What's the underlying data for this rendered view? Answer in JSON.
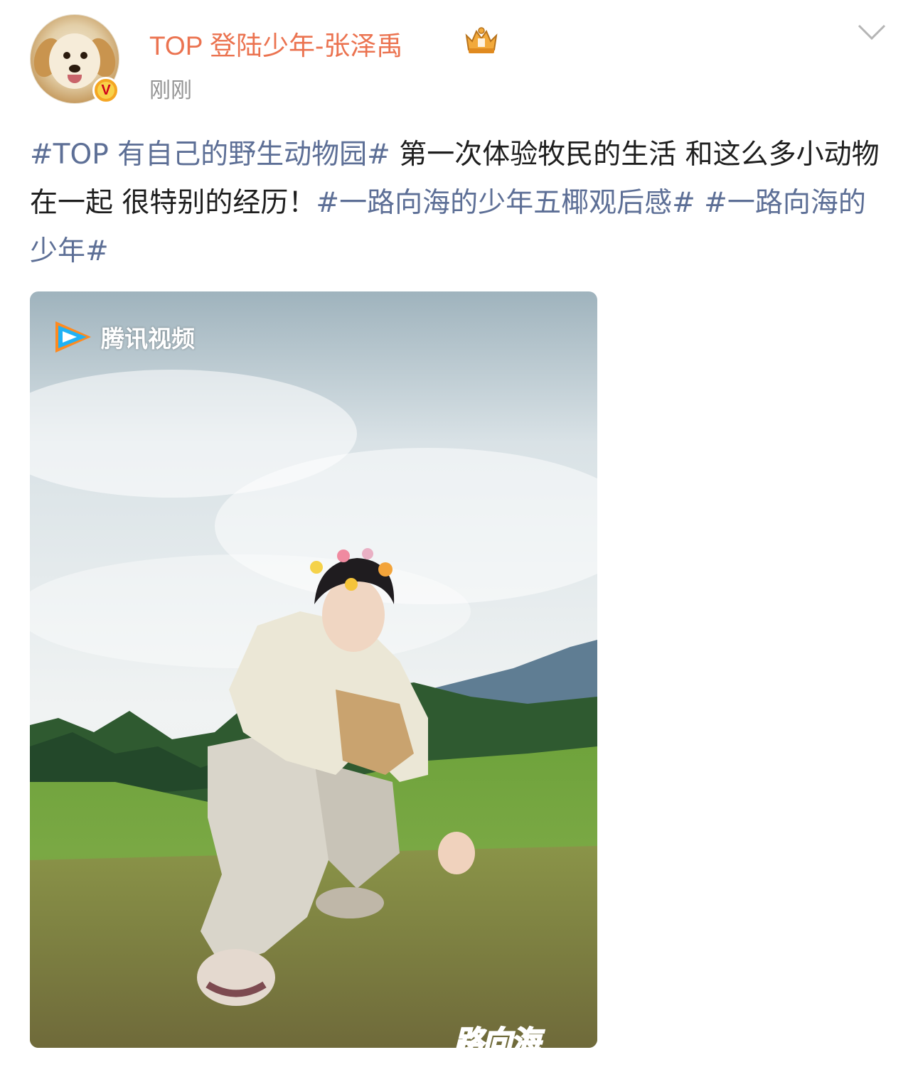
{
  "header": {
    "username": "TOP 登陆少年-张泽禹",
    "time": "刚刚",
    "verified_badge": "V"
  },
  "post": {
    "segments": [
      {
        "text": "#TOP 有自己的野生动物园#",
        "type": "hashtag"
      },
      {
        "text": " 第一次体验牧民的生活 和这么多小动物在一起 很特别的经历！",
        "type": "text"
      },
      {
        "text": "#一路向海的少年五椰观后感#",
        "type": "hashtag"
      },
      {
        "text": " ",
        "type": "text"
      },
      {
        "text": "#一路向海的少年#",
        "type": "hashtag"
      }
    ]
  },
  "image": {
    "watermark": "腾讯视频",
    "corner_text": "路向海"
  },
  "colors": {
    "username": "#eb7350",
    "hashtag": "#5d6f96",
    "body_text": "#1e1e1e",
    "time": "#939393"
  },
  "icons": [
    "avatar",
    "verified-badge-icon",
    "vip-crown-icon",
    "chevron-down-icon",
    "tencent-video-logo-icon"
  ]
}
